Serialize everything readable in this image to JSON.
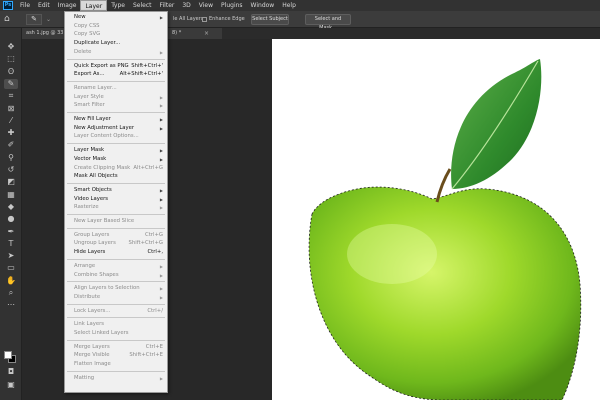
{
  "menubar": {
    "logo": "Ps",
    "items": [
      "File",
      "Edit",
      "Image",
      "Layer",
      "Type",
      "Select",
      "Filter",
      "3D",
      "View",
      "Plugins",
      "Window",
      "Help"
    ],
    "active": "Layer"
  },
  "options": {
    "sample_all_layers": "le All Layers",
    "enhance_edge": "Enhance Edge",
    "select_subject": "Select Subject",
    "select_and_mask": "Select and Mask..."
  },
  "tab": {
    "title_left": "ash 1.jpg @ 33.3",
    "title_right": "8) *"
  },
  "layer_menu": {
    "items": [
      {
        "label": "New",
        "arrow": true,
        "enabled": true
      },
      {
        "label": "Copy CSS",
        "enabled": false
      },
      {
        "label": "Copy SVG",
        "enabled": false
      },
      {
        "label": "Duplicate Layer...",
        "enabled": true
      },
      {
        "label": "Delete",
        "arrow": true,
        "enabled": false
      },
      {
        "sep": true
      },
      {
        "label": "Quick Export as PNG",
        "shortcut": "Shift+Ctrl+'",
        "enabled": true
      },
      {
        "label": "Export As...",
        "shortcut": "Alt+Shift+Ctrl+'",
        "enabled": true
      },
      {
        "sep": true
      },
      {
        "label": "Rename Layer...",
        "enabled": false
      },
      {
        "label": "Layer Style",
        "arrow": true,
        "enabled": false
      },
      {
        "label": "Smart Filter",
        "arrow": true,
        "enabled": false
      },
      {
        "sep": true
      },
      {
        "label": "New Fill Layer",
        "arrow": true,
        "enabled": true
      },
      {
        "label": "New Adjustment Layer",
        "arrow": true,
        "enabled": true
      },
      {
        "label": "Layer Content Options...",
        "enabled": false
      },
      {
        "sep": true
      },
      {
        "label": "Layer Mask",
        "arrow": true,
        "enabled": true
      },
      {
        "label": "Vector Mask",
        "arrow": true,
        "enabled": true
      },
      {
        "label": "Create Clipping Mask",
        "shortcut": "Alt+Ctrl+G",
        "enabled": false
      },
      {
        "label": "Mask All Objects",
        "enabled": true
      },
      {
        "sep": true
      },
      {
        "label": "Smart Objects",
        "arrow": true,
        "enabled": true
      },
      {
        "label": "Video Layers",
        "arrow": true,
        "enabled": true
      },
      {
        "label": "Rasterize",
        "arrow": true,
        "enabled": false
      },
      {
        "sep": true
      },
      {
        "label": "New Layer Based Slice",
        "enabled": false
      },
      {
        "sep": true
      },
      {
        "label": "Group Layers",
        "shortcut": "Ctrl+G",
        "enabled": false
      },
      {
        "label": "Ungroup Layers",
        "shortcut": "Shift+Ctrl+G",
        "enabled": false
      },
      {
        "label": "Hide Layers",
        "shortcut": "Ctrl+,",
        "enabled": true
      },
      {
        "sep": true
      },
      {
        "label": "Arrange",
        "arrow": true,
        "enabled": false
      },
      {
        "label": "Combine Shapes",
        "arrow": true,
        "enabled": false
      },
      {
        "sep": true
      },
      {
        "label": "Align Layers to Selection",
        "arrow": true,
        "enabled": false
      },
      {
        "label": "Distribute",
        "arrow": true,
        "enabled": false
      },
      {
        "sep": true
      },
      {
        "label": "Lock Layers...",
        "shortcut": "Ctrl+/",
        "enabled": false
      },
      {
        "sep": true
      },
      {
        "label": "Link Layers",
        "enabled": false
      },
      {
        "label": "Select Linked Layers",
        "enabled": false
      },
      {
        "sep": true
      },
      {
        "label": "Merge Layers",
        "shortcut": "Ctrl+E",
        "enabled": false
      },
      {
        "label": "Merge Visible",
        "shortcut": "Shift+Ctrl+E",
        "enabled": false
      },
      {
        "label": "Flatten Image",
        "enabled": false
      },
      {
        "sep": true
      },
      {
        "label": "Matting",
        "arrow": true,
        "enabled": false
      }
    ]
  },
  "tools": [
    {
      "icon": "move-icon",
      "glyph": "✥"
    },
    {
      "icon": "marquee-icon",
      "glyph": "⬚"
    },
    {
      "icon": "lasso-icon",
      "glyph": "ʘ"
    },
    {
      "icon": "quick-selection-icon",
      "glyph": "✎"
    },
    {
      "icon": "crop-icon",
      "glyph": "⌗"
    },
    {
      "icon": "frame-icon",
      "glyph": "⊠"
    },
    {
      "icon": "eyedropper-icon",
      "glyph": "⁄"
    },
    {
      "icon": "healing-brush-icon",
      "glyph": "✚"
    },
    {
      "icon": "brush-icon",
      "glyph": "✐"
    },
    {
      "icon": "clone-stamp-icon",
      "glyph": "⚲"
    },
    {
      "icon": "history-brush-icon",
      "glyph": "↺"
    },
    {
      "icon": "eraser-icon",
      "glyph": "◩"
    },
    {
      "icon": "gradient-icon",
      "glyph": "▦"
    },
    {
      "icon": "blur-icon",
      "glyph": "◆"
    },
    {
      "icon": "dodge-icon",
      "glyph": "●"
    },
    {
      "icon": "pen-icon",
      "glyph": "✒"
    },
    {
      "icon": "type-icon",
      "glyph": "T"
    },
    {
      "icon": "path-selection-icon",
      "glyph": "➤"
    },
    {
      "icon": "rectangle-icon",
      "glyph": "▭"
    },
    {
      "icon": "hand-icon",
      "glyph": "✋"
    },
    {
      "icon": "zoom-icon",
      "glyph": "⌕"
    },
    {
      "icon": "more-tools-icon",
      "glyph": "⋯"
    }
  ]
}
